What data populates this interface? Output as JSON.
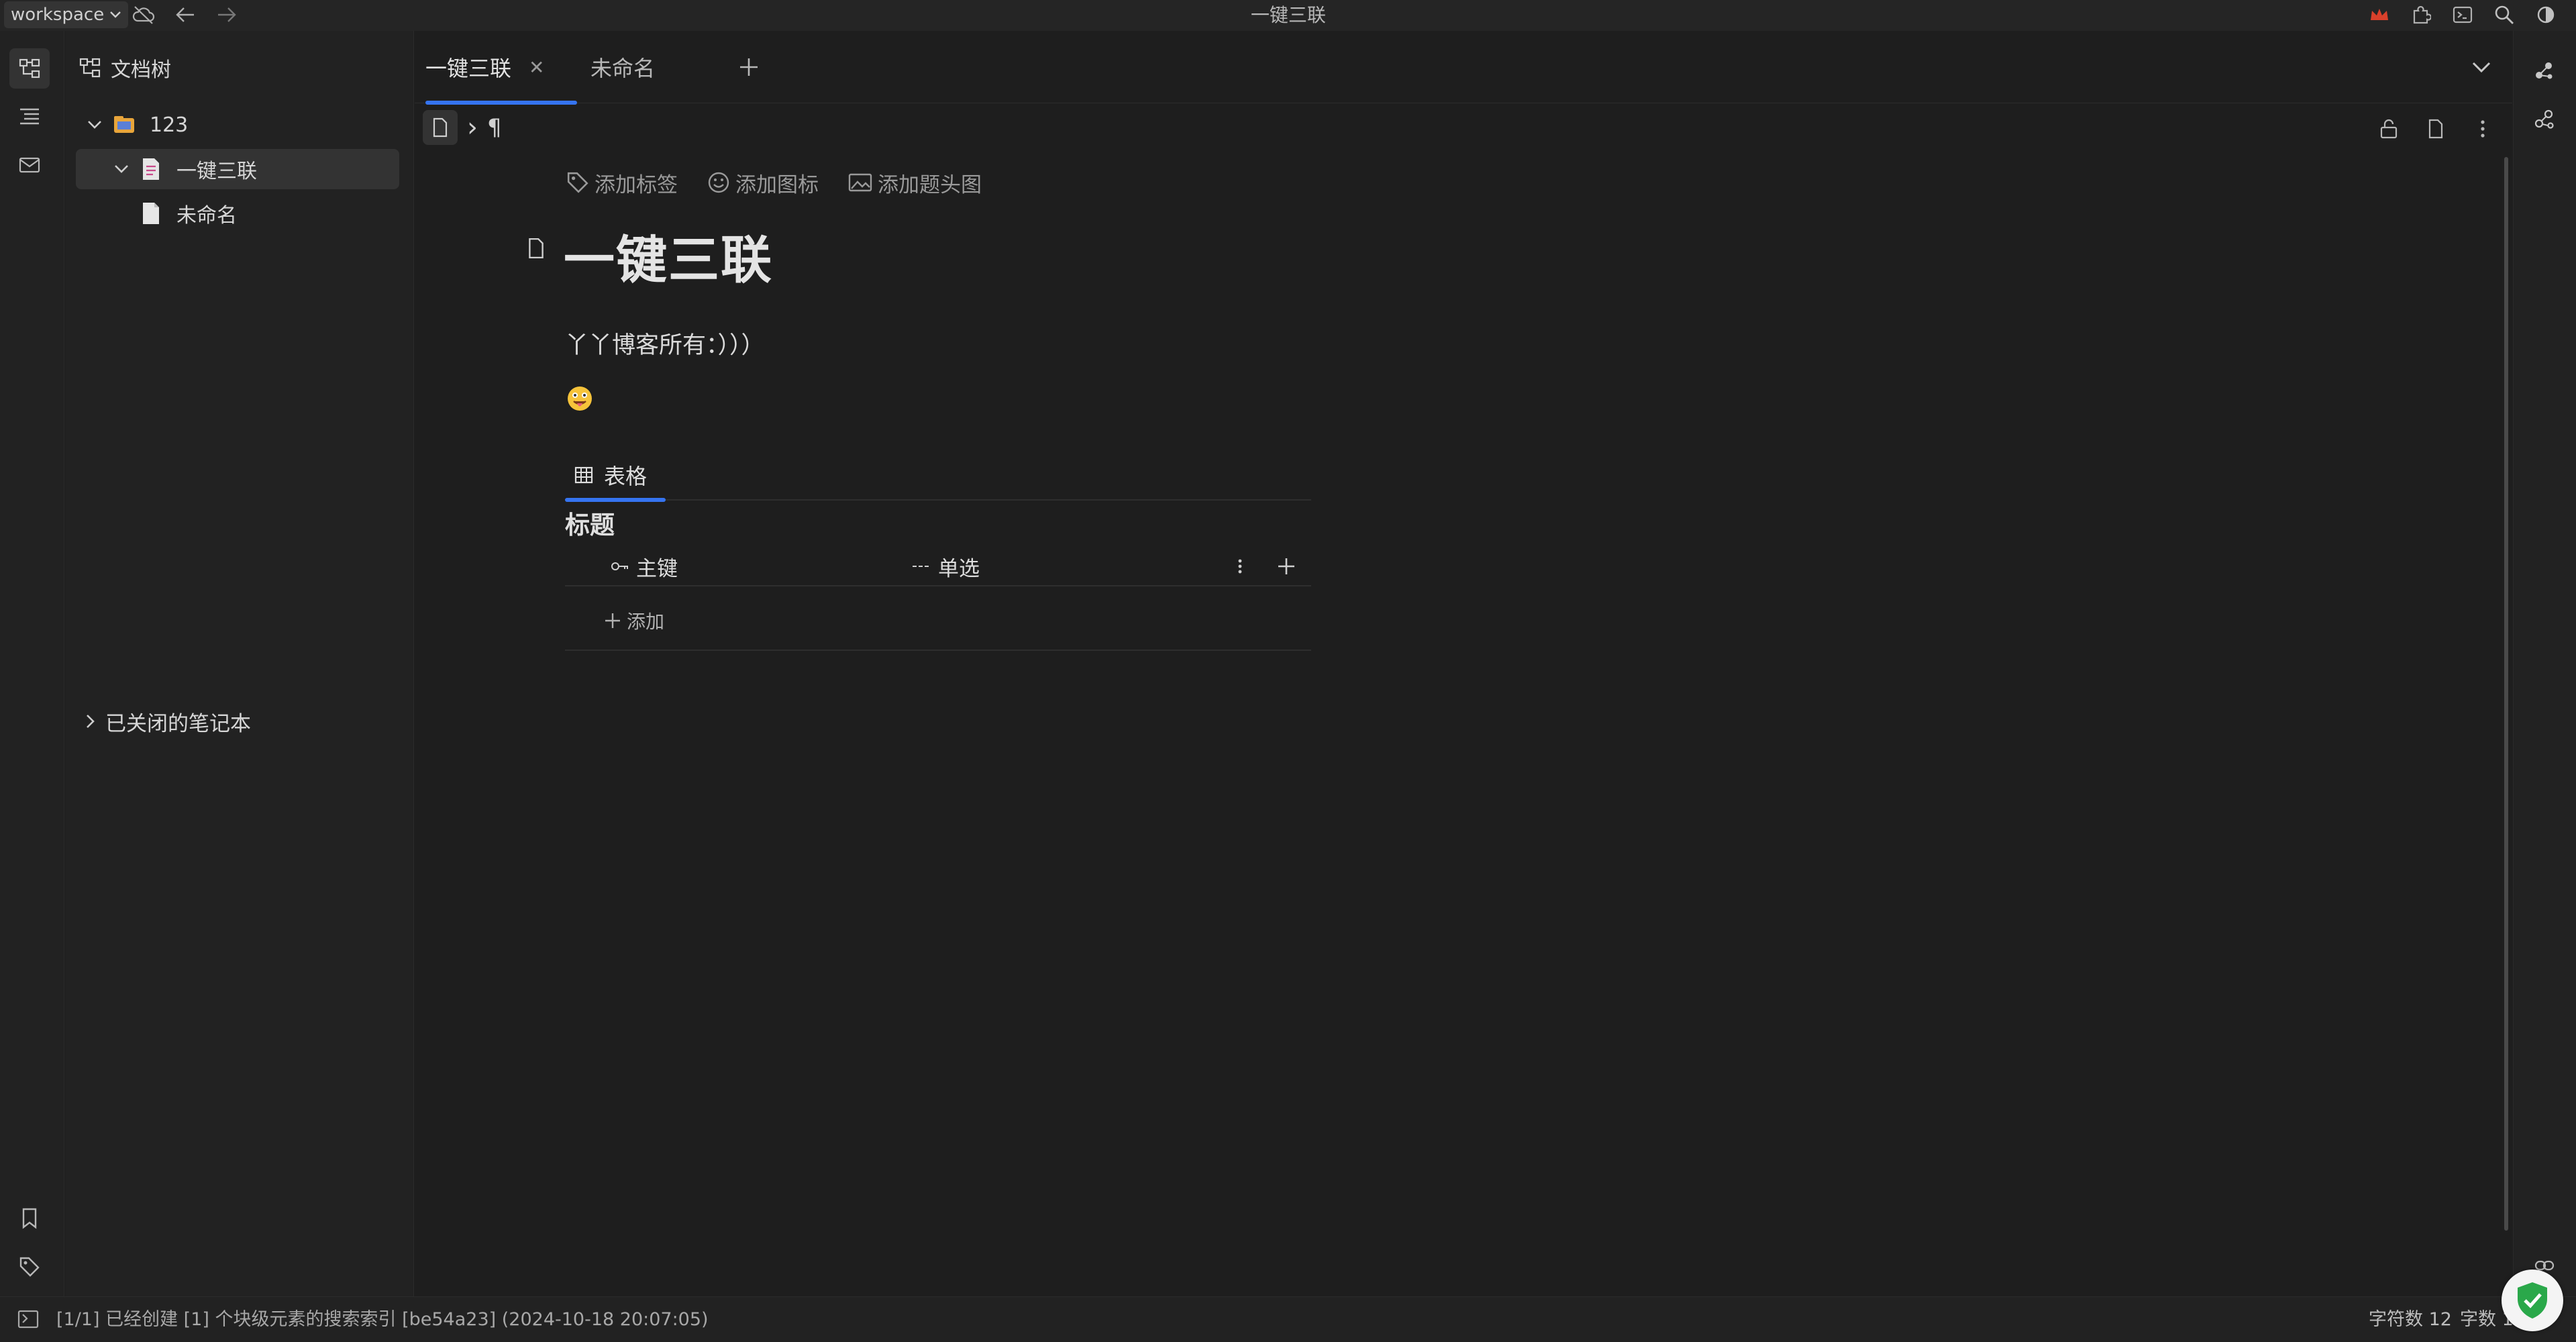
{
  "titlebar": {
    "workspace_label": "workspace",
    "window_title": "一键三联",
    "icons": [
      "cloud-off-icon",
      "back-arrow-icon",
      "forward-arrow-icon",
      "crown-icon",
      "puzzle-icon",
      "terminal-icon",
      "search-icon",
      "theme-mode-icon"
    ]
  },
  "left_dock": {
    "icons": [
      "file-tree-icon",
      "outline-icon",
      "inbox-icon",
      "bookmark-icon",
      "tag-icon"
    ]
  },
  "tree": {
    "header": "文档树",
    "notebook": "123",
    "items": [
      {
        "label": "一键三联",
        "selected": true
      },
      {
        "label": "未命名",
        "selected": false
      }
    ],
    "closed_notebooks": "已关闭的笔记本"
  },
  "tabs": {
    "items": [
      {
        "label": "一键三联",
        "active": true
      },
      {
        "label": "未命名",
        "active": false
      }
    ],
    "add": "+"
  },
  "breadcrumb": {
    "separator": "›",
    "paragraph_mark": "¶"
  },
  "doc": {
    "actions": {
      "add_tag": "添加标签",
      "add_icon": "添加图标",
      "add_cover": "添加题头图"
    },
    "title": "一键三联",
    "paragraph": "丫丫博客所有：）））",
    "emoji": "😛"
  },
  "database": {
    "view_tab": "表格",
    "title": "标题",
    "columns": [
      {
        "label": "主键",
        "icon": "key-icon"
      },
      {
        "label": "单选",
        "icon": "select-icon"
      }
    ],
    "add_row": "添加"
  },
  "statusbar": {
    "message": "[1/1] 已经创建 [1] 个块级元素的搜索索引 [be54a23] (2024-10-18 20:07:05)",
    "char_count": "字符数 12",
    "word_count": "字数 12"
  },
  "colors": {
    "accent": "#3574f0",
    "background": "#1e1e1e",
    "panel": "#222222",
    "shield": "#2aa84a"
  }
}
